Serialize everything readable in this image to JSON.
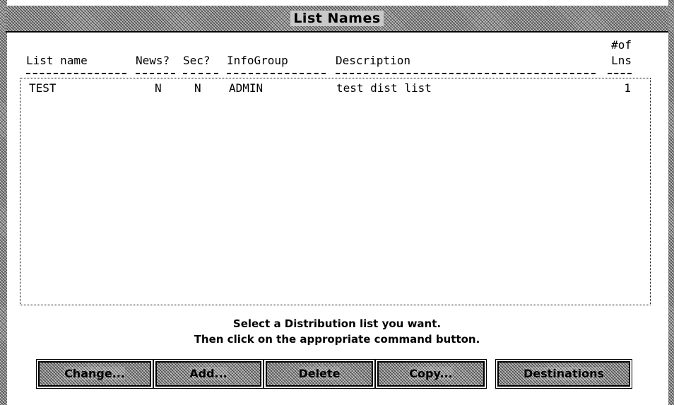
{
  "window": {
    "title": "List Names"
  },
  "columns": {
    "list_name": "List name",
    "news": "News?",
    "sec": "Sec?",
    "infogroup": "InfoGroup",
    "description": "Description",
    "lines_top": "#of",
    "lines_bottom": "Lns"
  },
  "rows": [
    {
      "list_name": "TEST",
      "news": "N",
      "sec": "N",
      "infogroup": "ADMIN",
      "description": "test dist list",
      "lines": "1"
    }
  ],
  "prompt": {
    "line1": "Select a Distribution list you want.",
    "line2": "Then click on the appropriate command button."
  },
  "buttons": {
    "change": "Change...",
    "add": "Add...",
    "delete": "Delete",
    "copy": "Copy...",
    "destinations": "Destinations"
  }
}
